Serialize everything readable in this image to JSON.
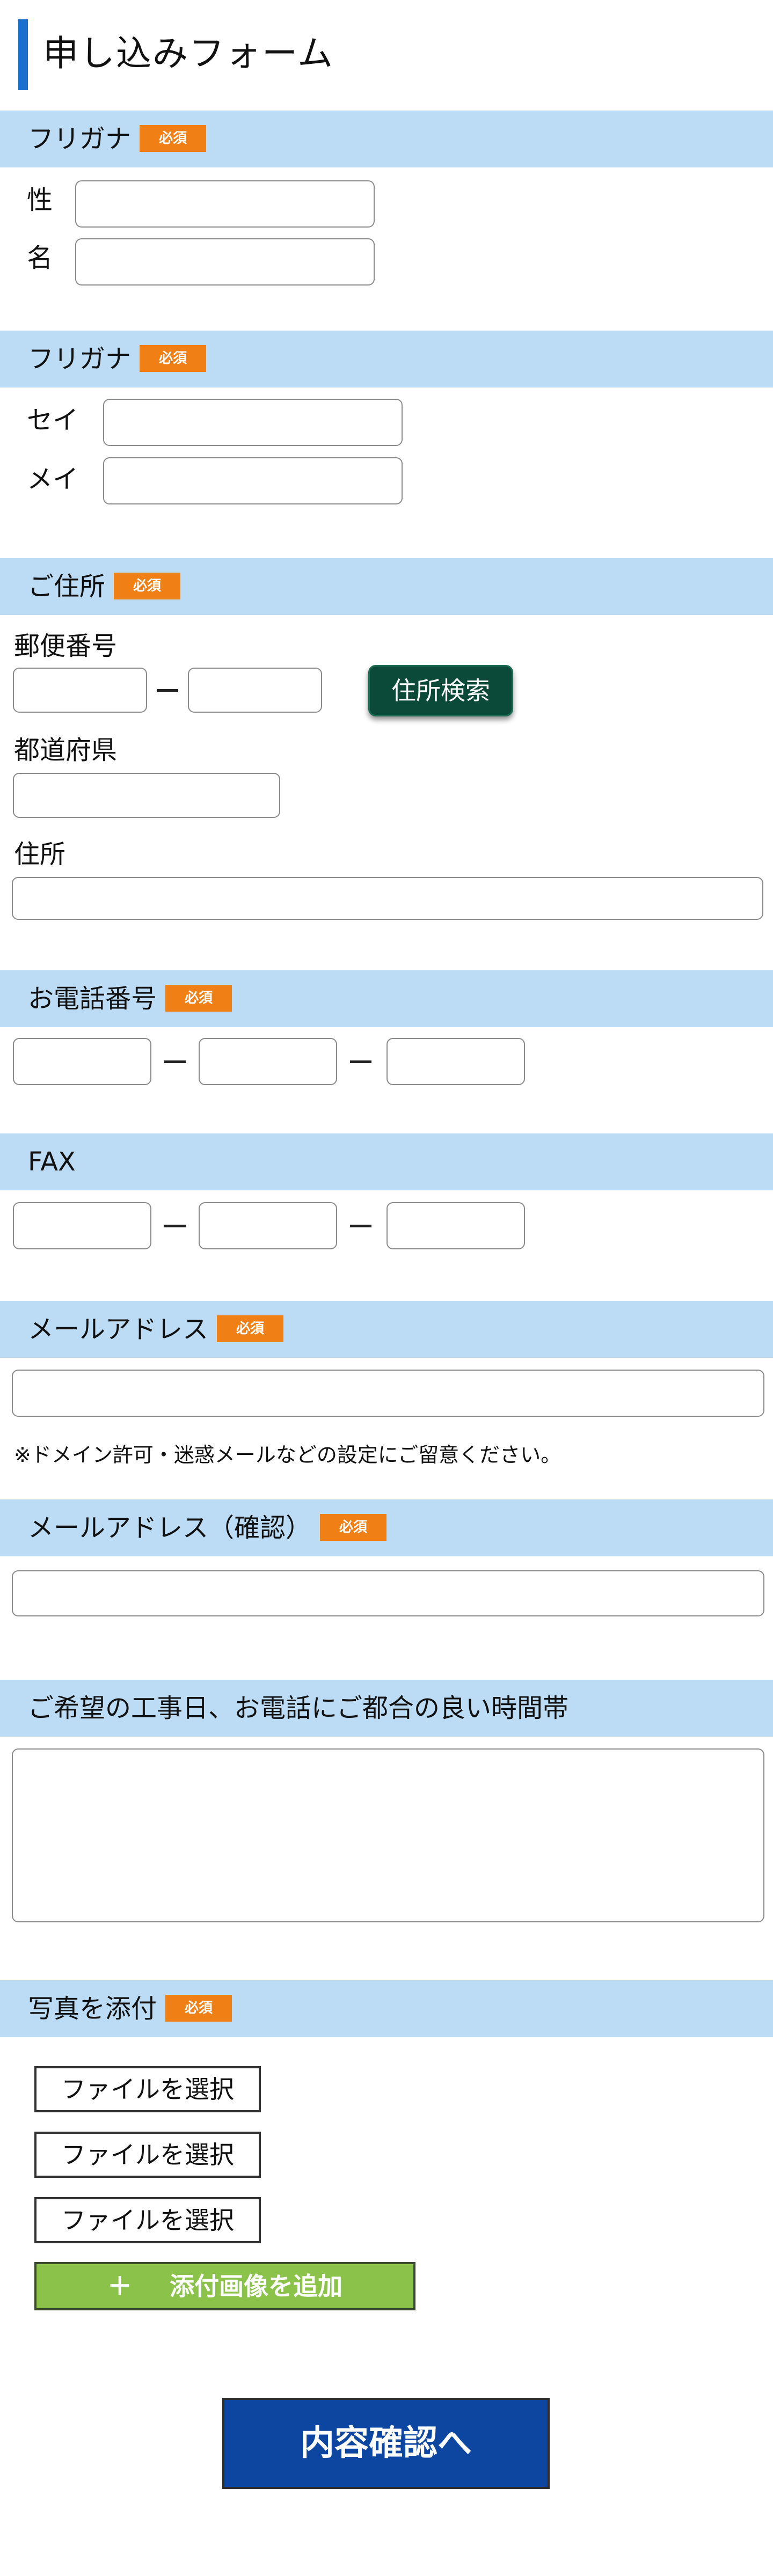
{
  "page_title": "申し込みフォーム",
  "badge_required": "必須",
  "sections": {
    "furigana1": {
      "label": "フリガナ",
      "field_last": "性",
      "field_first": "名"
    },
    "furigana2": {
      "label": "フリガナ",
      "field_last": "セイ",
      "field_first": "メイ"
    },
    "address": {
      "label": "ご住所",
      "postal_label": "郵便番号",
      "search_button": "住所検索",
      "prefecture_label": "都道府県",
      "address_label": "住所"
    },
    "phone": {
      "label": "お電話番号"
    },
    "fax": {
      "label": "FAX"
    },
    "email": {
      "label": "メールアドレス",
      "note": "※ドメイン許可・迷惑メールなどの設定にご留意ください。"
    },
    "email_confirm": {
      "label": "メールアドレス（確認）"
    },
    "preferred_time": {
      "label": "ご希望の工事日、お電話にご都合の良い時間帯"
    },
    "photos": {
      "label": "写真を添付",
      "file_button": "ファイルを選択",
      "add_icon": "＋",
      "add_button": "添付画像を追加"
    }
  },
  "submit_button": "内容確認へ",
  "colors": {
    "section_bg": "#bcdcf6",
    "badge": "#f07f16",
    "title_accent": "#1a6fcf",
    "search_button": "#0b4a38",
    "add_button": "#8bc34a",
    "submit_button": "#0d46a0"
  }
}
